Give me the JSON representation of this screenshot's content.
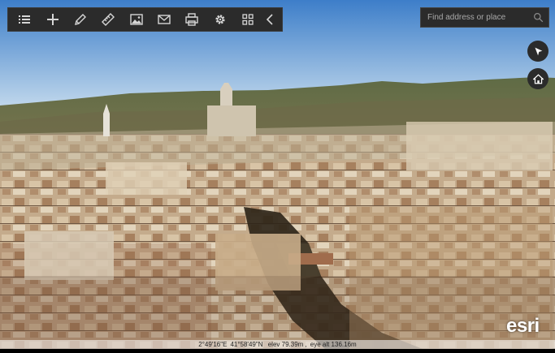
{
  "toolbar": {
    "buttons": [
      {
        "name": "layer-list-button",
        "icon": "list-icon"
      },
      {
        "name": "add-button",
        "icon": "plus-icon"
      },
      {
        "name": "sketch-button",
        "icon": "pencil-icon"
      },
      {
        "name": "measure-button",
        "icon": "ruler-icon"
      },
      {
        "name": "basemap-button",
        "icon": "image-icon"
      },
      {
        "name": "share-button",
        "icon": "envelope-icon"
      },
      {
        "name": "print-button",
        "icon": "printer-icon"
      },
      {
        "name": "settings-button",
        "icon": "gear-icon"
      },
      {
        "name": "apps-button",
        "icon": "grid-icon"
      },
      {
        "name": "collapse-button",
        "icon": "chevron-left-icon"
      }
    ]
  },
  "search": {
    "placeholder": "Find address or place",
    "value": ""
  },
  "map_controls": {
    "navigation_icon": "compass-arrow-icon",
    "home_icon": "home-icon"
  },
  "attribution": {
    "logo_text": "esri"
  },
  "status_bar": {
    "longitude": "2°49'16\"E",
    "latitude": "41°58'49\"N",
    "elevation": "elev 79.39m",
    "eye_altitude": "eye alt 136.16m"
  },
  "colors": {
    "panel_bg": "#2b2b2b",
    "icon": "#d6d6d6",
    "sky_top": "#3d7ec9",
    "sky_bottom": "#c6dced"
  }
}
